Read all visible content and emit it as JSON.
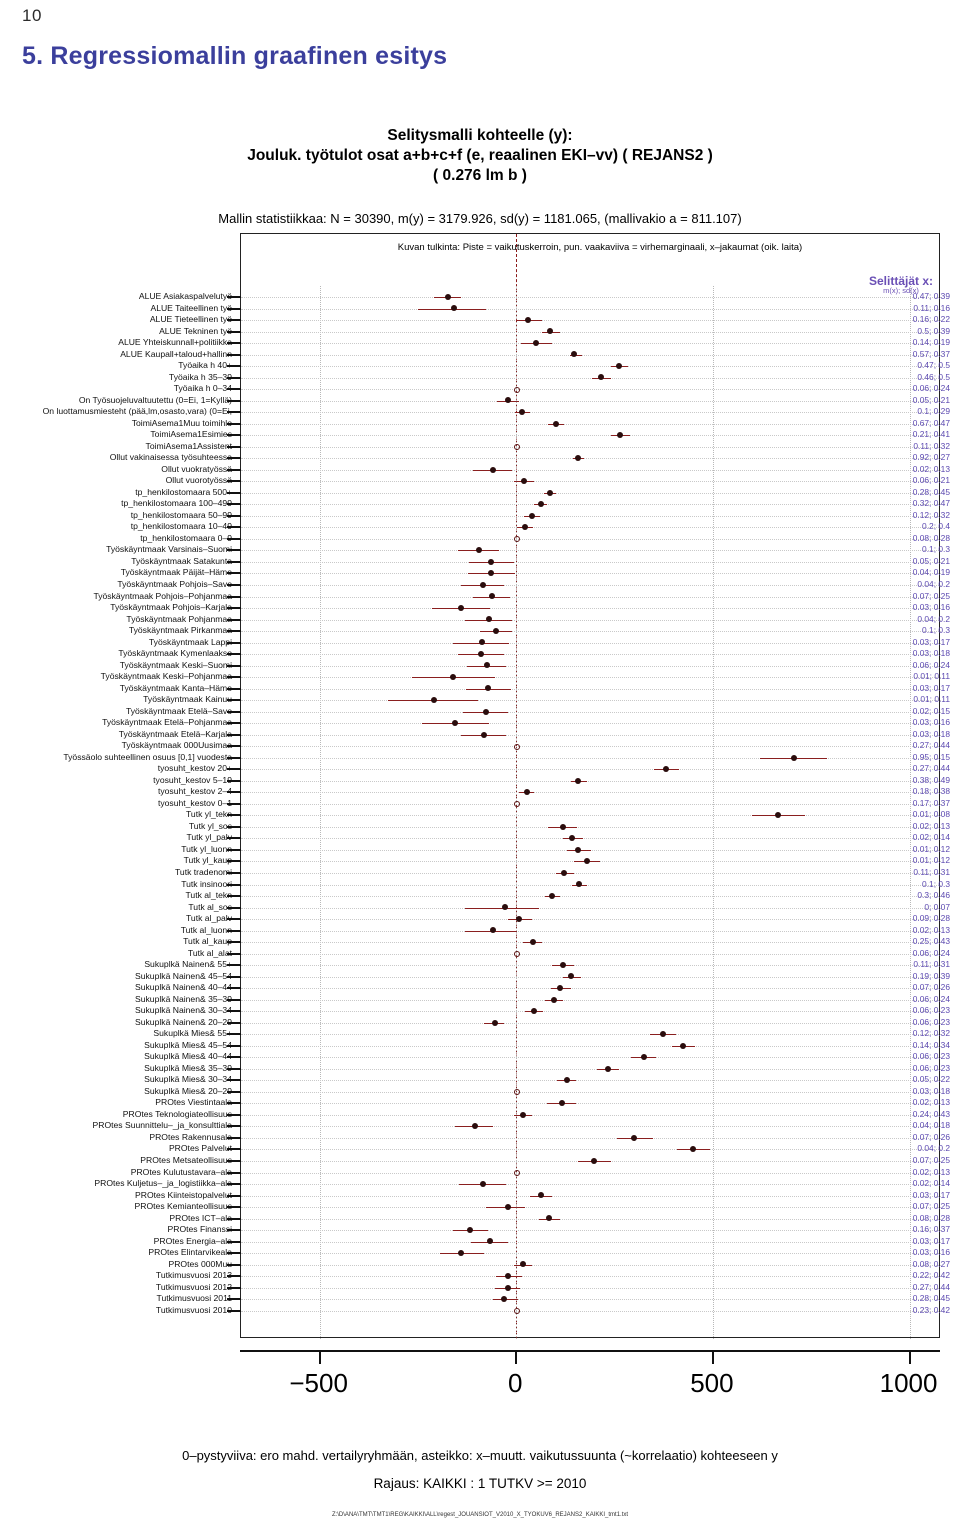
{
  "slide": {
    "number": "10",
    "title": "5. Regressiomallin graafinen esitys"
  },
  "plot": {
    "title_line1": "Selitysmalli kohteelle (y):",
    "title_line2": "Jouluk. työtulot osat a+b+c+f (e, reaalinen EKI–vv) ( REJANS2 )",
    "title_line3": "( 0.276 lm b )",
    "stats_prefix": "Mallin statistiikkaa: N = 30390, m(y) = 3179.926, sd(y) = 1181.065, (mallivakio a = 811.107)",
    "stats_overlap": "m(y) = 3179.926, sd(y) = 1181.065",
    "interpretation": "Kuvan tulkinta: Piste = vaikutuskerroin, pun. vaakaviiva = virhemarginaali, x–jakaumat (oik. laita)",
    "values_header_line1": "Selittäjät x:",
    "values_header_line2": "m(x); sd(x)",
    "footer_note": "0–pystyviiva: ero mahd. vertailyryhmään, asteikko: x–muutt. vaikutussuunta (~korrelaatio) kohteeseen y",
    "footer_limit": "Rajaus: KAIKKI : 1  TUTKV >= 2010",
    "footer_path": "Z:\\D\\ANA\\TMT\\TMT1\\REG\\KAIKKI\\ALL\\regest_JOUANSIOT_V2010_X_TYOKUV6_REJANS2_KAIKKI_tmt1.txt",
    "accent_point": "#2a0d0d",
    "accent_bar": "#8a1f1f",
    "accent_zero": "#8b1a1a",
    "accent_values": "#5b48b0",
    "accent_title": "#3b3f9c"
  },
  "chart_data": {
    "type": "scatter",
    "title": "Selitysmalli kohteelle (y): Jouluk. työtulot osat a+b+c+f (e, reaalinen EKI–vv) ( REJANS2 ) ( 0.276 lm b )",
    "xlabel": "",
    "ylabel": "",
    "xlim": [
      -700,
      1080
    ],
    "xticks": [
      -500,
      0,
      500,
      1000
    ],
    "xticklabels": [
      "−500",
      "0",
      "500",
      "1000"
    ],
    "grid": true,
    "legend": "none",
    "annotation": "Piste = vaikutuskerroin, pun. vaakaviiva = virhemarginaali",
    "series_name": "vaikutuskerroin",
    "rows": [
      {
        "label": "ALUE Asiakaspalvelutyö",
        "est": -174,
        "lo": -210,
        "hi": -140,
        "mx": "0.47; 0.39"
      },
      {
        "label": "ALUE Taiteellinen työ",
        "est": -159,
        "lo": -249,
        "hi": -78,
        "mx": "0.11; 0.16"
      },
      {
        "label": "ALUE Tieteellinen työ",
        "est": 31,
        "lo": 0,
        "hi": 66,
        "mx": "0.16; 0.22"
      },
      {
        "label": "ALUE Tekninen työ",
        "est": 85,
        "lo": 65,
        "hi": 112,
        "mx": "0.5; 0.39"
      },
      {
        "label": "ALUE Yhteiskunnall+politiikka",
        "est": 50,
        "lo": 12,
        "hi": 90,
        "mx": "0.14; 0.19"
      },
      {
        "label": "ALUE Kaupall+taloud+hallinn",
        "est": 148,
        "lo": 136,
        "hi": 168,
        "mx": "0.57; 0.37"
      },
      {
        "label": "Työaika h 40+",
        "est": 260,
        "lo": 240,
        "hi": 285,
        "mx": "0.47; 0.5"
      },
      {
        "label": "Työaika h 35–39",
        "est": 215,
        "lo": 192,
        "hi": 240,
        "mx": "0.46; 0.5"
      },
      {
        "label": "Työaika h 0–34",
        "est": 0,
        "lo": 0,
        "hi": 0,
        "mx": "0.06; 0.24",
        "hollow": true
      },
      {
        "label": "On Työsuojeluvaltuutettu (0=Ei, 1=Kyllä)",
        "est": -20,
        "lo": -50,
        "hi": 6,
        "mx": "0.05; 0.21"
      },
      {
        "label": "On luottamusmiesteht  (pää,lm,osasto,vara) (0=Ei,",
        "est": 15,
        "lo": -2,
        "hi": 36,
        "mx": "0.1; 0.29"
      },
      {
        "label": "ToimiAsema1Muu toimihlo",
        "est": 100,
        "lo": 80,
        "hi": 122,
        "mx": "0.67; 0.47"
      },
      {
        "label": "ToimiAsema1Esimies",
        "est": 265,
        "lo": 240,
        "hi": 290,
        "mx": "0.21; 0.41"
      },
      {
        "label": "ToimiAsema1Assistent",
        "est": 0,
        "lo": 0,
        "hi": 0,
        "mx": "0.11; 0.32",
        "hollow": true
      },
      {
        "label": "Ollut vakinaisessa työsuhteessa",
        "est": 156,
        "lo": 143,
        "hi": 172,
        "mx": "0.92; 0.27"
      },
      {
        "label": "Ollut vuokratyössä",
        "est": -60,
        "lo": -110,
        "hi": -10,
        "mx": "0.02; 0.13"
      },
      {
        "label": "Ollut vuorotyössä",
        "est": 20,
        "lo": -5,
        "hi": 45,
        "mx": "0.06; 0.21"
      },
      {
        "label": "tp_henkilostomaara 500+",
        "est": 86,
        "lo": 70,
        "hi": 102,
        "mx": "0.28; 0.45"
      },
      {
        "label": "tp_henkilostomaara 100–499",
        "est": 62,
        "lo": 45,
        "hi": 78,
        "mx": "0.32; 0.47"
      },
      {
        "label": "tp_henkilostomaara 50–99",
        "est": 40,
        "lo": 20,
        "hi": 60,
        "mx": "0.12; 0.32"
      },
      {
        "label": "tp_henkilostomaara 10–49",
        "est": 22,
        "lo": 2,
        "hi": 42,
        "mx": "0.2; 0.4"
      },
      {
        "label": "tp_henkilostomaara 0–9",
        "est": 0,
        "lo": 0,
        "hi": 0,
        "mx": "0.08; 0.28",
        "hollow": true
      },
      {
        "label": "Työskäyntmaak  Varsinais–Suomi",
        "est": -95,
        "lo": -148,
        "hi": -43,
        "mx": "0.1; 0.3"
      },
      {
        "label": "Työskäyntmaak  Satakunta",
        "est": -65,
        "lo": -120,
        "hi": -6,
        "mx": "0.05; 0.21"
      },
      {
        "label": "Työskäyntmaak  Päijät–Häme",
        "est": -65,
        "lo": -124,
        "hi": -2,
        "mx": "0.04; 0.19"
      },
      {
        "label": "Työskäyntmaak  Pohjois–Savo",
        "est": -85,
        "lo": -140,
        "hi": -32,
        "mx": "0.04; 0.2"
      },
      {
        "label": "Työskäyntmaak  Pohjois–Pohjanmaa",
        "est": -62,
        "lo": -110,
        "hi": -15,
        "mx": "0.07; 0.25"
      },
      {
        "label": "Työskäyntmaak  Pohjois–Karjala",
        "est": -140,
        "lo": -215,
        "hi": -68,
        "mx": "0.03; 0.16"
      },
      {
        "label": "Työskäyntmaak  Pohjanmaa",
        "est": -70,
        "lo": -130,
        "hi": -10,
        "mx": "0.04; 0.2"
      },
      {
        "label": "Työskäyntmaak  Pirkanmaa",
        "est": -52,
        "lo": -92,
        "hi": -12,
        "mx": "0.1; 0.3"
      },
      {
        "label": "Työskäyntmaak  Lappi",
        "est": -88,
        "lo": -160,
        "hi": -18,
        "mx": "0.03; 0.17"
      },
      {
        "label": "Työskäyntmaak  Kymenlaakso",
        "est": -90,
        "lo": -148,
        "hi": -32,
        "mx": "0.03; 0.18"
      },
      {
        "label": "Työskäyntmaak  Keski–Suomi",
        "est": -75,
        "lo": -125,
        "hi": -25,
        "mx": "0.06; 0.24"
      },
      {
        "label": "Työskäyntmaak  Keski–Pohjanmaa",
        "est": -160,
        "lo": -265,
        "hi": -55,
        "mx": "0.01; 0.11"
      },
      {
        "label": "Työskäyntmaak  Kanta–Häme",
        "est": -72,
        "lo": -128,
        "hi": -14,
        "mx": "0.03; 0.17"
      },
      {
        "label": "Työskäyntmaak  Kainuu",
        "est": -210,
        "lo": -325,
        "hi": -98,
        "mx": "0.01; 0.11"
      },
      {
        "label": "Työskäyntmaak  Etelä–Savo",
        "est": -78,
        "lo": -135,
        "hi": -22,
        "mx": "0.02; 0.15"
      },
      {
        "label": "Työskäyntmaak  Etelä–Pohjanmaa",
        "est": -155,
        "lo": -240,
        "hi": -70,
        "mx": "0.03; 0.16"
      },
      {
        "label": "Työskäyntmaak  Etelä–Karjala",
        "est": -82,
        "lo": -140,
        "hi": -26,
        "mx": "0.03; 0.18"
      },
      {
        "label": "Työskäyntmaak  000Uusimaa",
        "est": 0,
        "lo": 0,
        "hi": 0,
        "mx": "0.27; 0.44",
        "hollow": true
      },
      {
        "label": "Työssäolo suhteellinen osuus [0,1] vuodesta",
        "est": 705,
        "lo": 620,
        "hi": 790,
        "mx": "0.95; 0.15"
      },
      {
        "label": "tyosuht_kestov 20+",
        "est": 380,
        "lo": 350,
        "hi": 415,
        "mx": "0.27; 0.44"
      },
      {
        "label": "tyosuht_kestov 5–19",
        "est": 158,
        "lo": 140,
        "hi": 180,
        "mx": "0.38; 0.49"
      },
      {
        "label": "tyosuht_kestov 2–4",
        "est": 26,
        "lo": 6,
        "hi": 46,
        "mx": "0.18; 0.38"
      },
      {
        "label": "tyosuht_kestov 0–1",
        "est": 0,
        "lo": 0,
        "hi": 0,
        "mx": "0.17; 0.37",
        "hollow": true
      },
      {
        "label": "Tutk yl_tekn",
        "est": 665,
        "lo": 600,
        "hi": 735,
        "mx": "0.01; 0.08"
      },
      {
        "label": "Tutk yl_sos",
        "est": 118,
        "lo": 80,
        "hi": 155,
        "mx": "0.02; 0.13"
      },
      {
        "label": "Tutk yl_palv",
        "est": 142,
        "lo": 118,
        "hi": 170,
        "mx": "0.02; 0.14"
      },
      {
        "label": "Tutk yl_luonn",
        "est": 158,
        "lo": 130,
        "hi": 190,
        "mx": "0.01; 0.12"
      },
      {
        "label": "Tutk yl_kaup",
        "est": 180,
        "lo": 148,
        "hi": 212,
        "mx": "0.01; 0.12"
      },
      {
        "label": "Tutk tradenomi",
        "est": 122,
        "lo": 100,
        "hi": 148,
        "mx": "0.11; 0.31"
      },
      {
        "label": "Tutk insinoori",
        "est": 160,
        "lo": 142,
        "hi": 180,
        "mx": "0.1; 0.3"
      },
      {
        "label": "Tutk al_tekn",
        "est": 92,
        "lo": 72,
        "hi": 112,
        "mx": "0.3; 0.46"
      },
      {
        "label": "Tutk al_sos",
        "est": -28,
        "lo": -130,
        "hi": 58,
        "mx": "0; 0.07"
      },
      {
        "label": "Tutk al_palv",
        "est": 6,
        "lo": -20,
        "hi": 40,
        "mx": "0.09; 0.28"
      },
      {
        "label": "Tutk al_luonn",
        "est": -60,
        "lo": -130,
        "hi": 2,
        "mx": "0.02; 0.13"
      },
      {
        "label": "Tutk al_kaup",
        "est": 42,
        "lo": 18,
        "hi": 66,
        "mx": "0.25; 0.43"
      },
      {
        "label": "Tutk al_alat",
        "est": 0,
        "lo": 0,
        "hi": 0,
        "mx": "0.06; 0.24",
        "hollow": true
      },
      {
        "label": "Sukuplkä Nainen& 55+",
        "est": 118,
        "lo": 92,
        "hi": 148,
        "mx": "0.11; 0.31"
      },
      {
        "label": "Sukuplkä Nainen& 45–54",
        "est": 140,
        "lo": 118,
        "hi": 164,
        "mx": "0.19; 0.39"
      },
      {
        "label": "Sukuplkä Nainen& 40–44",
        "est": 112,
        "lo": 88,
        "hi": 140,
        "mx": "0.07; 0.26"
      },
      {
        "label": "Sukuplkä Nainen& 35–39",
        "est": 95,
        "lo": 72,
        "hi": 118,
        "mx": "0.06; 0.24"
      },
      {
        "label": "Sukuplkä Nainen& 30–34",
        "est": 45,
        "lo": 22,
        "hi": 68,
        "mx": "0.06; 0.23"
      },
      {
        "label": "Sukuplkä Nainen& 20–29",
        "est": -55,
        "lo": -82,
        "hi": -30,
        "mx": "0.06; 0.23"
      },
      {
        "label": "Sukuplkä Mies& 55+",
        "est": 372,
        "lo": 340,
        "hi": 405,
        "mx": "0.12; 0.32"
      },
      {
        "label": "Sukuplkä Mies& 45–54",
        "est": 425,
        "lo": 395,
        "hi": 455,
        "mx": "0.14; 0.34"
      },
      {
        "label": "Sukuplkä Mies& 40–44",
        "est": 325,
        "lo": 292,
        "hi": 355,
        "mx": "0.06; 0.23"
      },
      {
        "label": "Sukuplkä Mies& 35–39",
        "est": 232,
        "lo": 205,
        "hi": 262,
        "mx": "0.06; 0.23"
      },
      {
        "label": "Sukuplkä Mies& 30–34",
        "est": 128,
        "lo": 104,
        "hi": 152,
        "mx": "0.05; 0.22"
      },
      {
        "label": "Sukuplkä Mies& 20–29",
        "est": 0,
        "lo": 0,
        "hi": 0,
        "mx": "0.03; 0.18",
        "hollow": true
      },
      {
        "label": "PROtes Viestintaala",
        "est": 115,
        "lo": 78,
        "hi": 152,
        "mx": "0.02; 0.13"
      },
      {
        "label": "PROtes Teknologiateollisuus",
        "est": 18,
        "lo": -5,
        "hi": 40,
        "mx": "0.24; 0.43"
      },
      {
        "label": "PROtes Suunnittelu–_ja_konsulttiala",
        "est": -105,
        "lo": -155,
        "hi": -58,
        "mx": "0.04; 0.18"
      },
      {
        "label": "PROtes Rakennusala",
        "est": 300,
        "lo": 255,
        "hi": 348,
        "mx": "0.07; 0.26"
      },
      {
        "label": "PROtes Palvelut",
        "est": 450,
        "lo": 408,
        "hi": 492,
        "mx": "0.04; 0.2"
      },
      {
        "label": "PROtes Metsateollisuus",
        "est": 198,
        "lo": 158,
        "hi": 240,
        "mx": "0.07; 0.25"
      },
      {
        "label": "PROtes Kulutustavara–ala",
        "est": 0,
        "lo": 0,
        "hi": 0,
        "mx": "0.02; 0.13",
        "hollow": true
      },
      {
        "label": "PROtes Kuljetus–_ja_logistiikka–ala",
        "est": -85,
        "lo": -145,
        "hi": -25,
        "mx": "0.02; 0.14"
      },
      {
        "label": "PROtes Kiinteistopalvelut",
        "est": 62,
        "lo": 35,
        "hi": 92,
        "mx": "0.03; 0.17"
      },
      {
        "label": "PROtes Kemianteollisuus",
        "est": -22,
        "lo": -78,
        "hi": 22,
        "mx": "0.07; 0.25"
      },
      {
        "label": "PROtes ICT–ala",
        "est": 82,
        "lo": 58,
        "hi": 110,
        "mx": "0.08; 0.28"
      },
      {
        "label": "PROtes Finanssi",
        "est": -118,
        "lo": -162,
        "hi": -72,
        "mx": "0.16; 0.37"
      },
      {
        "label": "PROtes Energia–ala",
        "est": -68,
        "lo": -115,
        "hi": -20,
        "mx": "0.03; 0.17"
      },
      {
        "label": "PROtes Elintarvikeala",
        "est": -140,
        "lo": -195,
        "hi": -82,
        "mx": "0.03; 0.16"
      },
      {
        "label": "PROtes 000Muu",
        "est": 18,
        "lo": -5,
        "hi": 40,
        "mx": "0.08; 0.27"
      },
      {
        "label": "Tutkimusvuosi  2013",
        "est": -20,
        "lo": -52,
        "hi": 14,
        "mx": "0.22; 0.42"
      },
      {
        "label": "Tutkimusvuosi  2012",
        "est": -22,
        "lo": -55,
        "hi": 10,
        "mx": "0.27; 0.44"
      },
      {
        "label": "Tutkimusvuosi  2011",
        "est": -30,
        "lo": -58,
        "hi": 4,
        "mx": "0.28; 0.45"
      },
      {
        "label": "Tutkimusvuosi  2010",
        "est": 0,
        "lo": 0,
        "hi": 0,
        "mx": "0.23; 0.42",
        "hollow": true
      }
    ]
  }
}
